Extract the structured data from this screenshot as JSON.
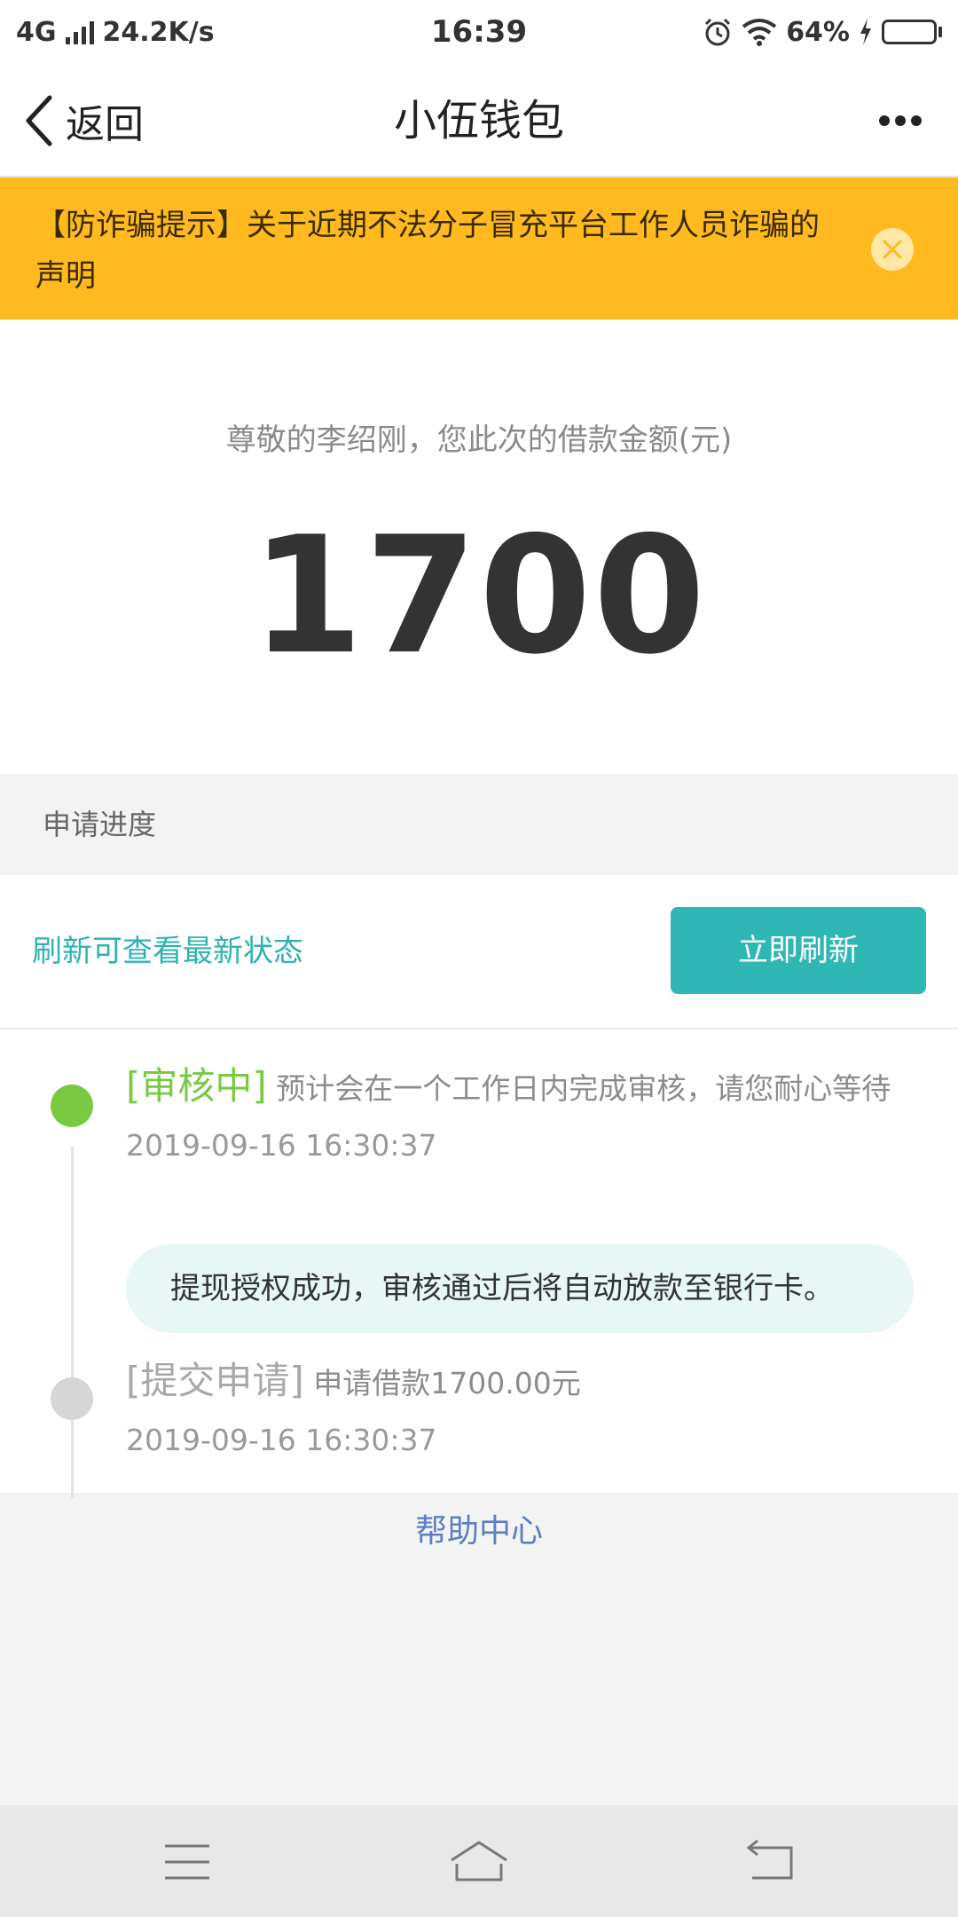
{
  "status_bar": {
    "network": "4G",
    "speed": "24.2K/s",
    "time": "16:39",
    "battery": "64%",
    "battery_level": 0.64
  },
  "nav": {
    "back_label": "返回",
    "title": "小伍钱包"
  },
  "notice": {
    "text": "【防诈骗提示】关于近期不法分子冒充平台工作人员诈骗的声明"
  },
  "loan": {
    "greeting": "尊敬的李绍刚，您此次的借款金额(元)",
    "amount": "1700"
  },
  "progress": {
    "header": "申请进度",
    "refresh_hint": "刷新可查看最新状态",
    "refresh_button": "立即刷新",
    "steps": [
      {
        "status": "[审核中]",
        "desc": "预计会在一个工作日内完成审核，请您耐心等待",
        "time": "2019-09-16 16:30:37"
      },
      {
        "status": "[提交申请]",
        "desc": "申请借款1700.00元",
        "time": "2019-09-16 16:30:37"
      }
    ],
    "bubble": "提现授权成功，审核通过后将自动放款至银行卡。"
  },
  "help": {
    "label": "帮助中心"
  },
  "colors": {
    "accent_teal": "#2fb7b6",
    "notice_yellow": "#ffba1f",
    "active_green": "#7ac943",
    "inactive_gray": "#d6d6d6",
    "link_blue": "#5b7fc2"
  },
  "icons": {
    "back": "chevron-left-icon",
    "more": "more-dots-icon",
    "close": "close-icon",
    "menu": "menu-icon",
    "home": "home-icon",
    "return": "return-icon"
  }
}
